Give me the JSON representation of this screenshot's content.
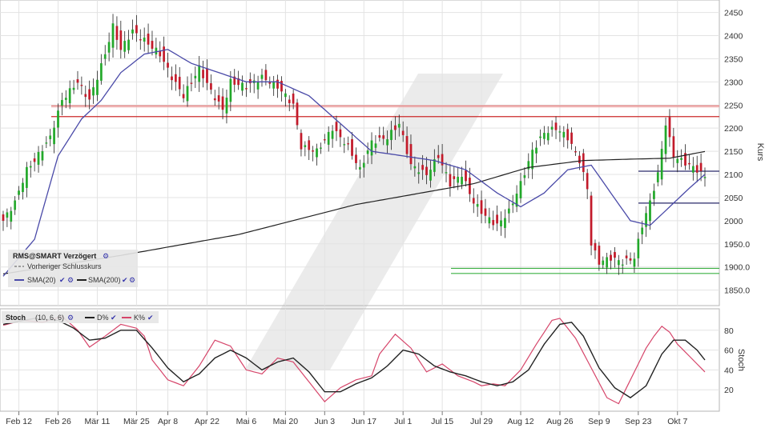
{
  "legend": {
    "symbol": "RMS@SMART Verzögert",
    "prev_close": "Vorheriger Schlusskurs",
    "sma20": "SMA(20)",
    "sma200": "SMA(200)",
    "stoch": "Stoch",
    "stoch_params": "(10, 6, 6)",
    "d_label": "D%",
    "k_label": "K%"
  },
  "colors": {
    "up": "#22a82a",
    "down": "#c21a2a",
    "sma20": "#4a4aa8",
    "sma200": "#222222",
    "resistance": "#cc2a2a",
    "support": "#3cb043",
    "k_line": "#d6456a",
    "d_line": "#222222",
    "grid": "#e3e3e3"
  },
  "chart_data": [
    {
      "type": "candlestick",
      "ylabel": "Kurs",
      "ylim": [
        1820,
        2470
      ],
      "yticks": [
        "2450",
        "2400",
        "2350",
        "2300",
        "2250",
        "2200",
        "2150",
        "2100",
        "2050",
        "2000",
        "1950.0",
        "1900.0",
        "1850.0"
      ],
      "ytick_values": [
        2450,
        2400,
        2350,
        2300,
        2250,
        2200,
        2150,
        2100,
        2050,
        2000,
        1950,
        1900,
        1850
      ],
      "xticks": [
        "Feb 12",
        "Feb 26",
        "Mär 11",
        "Mär 25",
        "Apr 8",
        "Apr 22",
        "Mai 6",
        "Mai 20",
        "Jun 3",
        "Jun 17",
        "Jul 1",
        "Jul 15",
        "Jul 29",
        "Aug 12",
        "Aug 26",
        "Sep 9",
        "Sep 23",
        "Okt 7"
      ],
      "xtick_index": [
        4,
        14,
        24,
        34,
        42,
        52,
        62,
        72,
        82,
        92,
        102,
        112,
        122,
        132,
        142,
        152,
        162,
        172
      ],
      "n_bars": 180,
      "close_anchors": [
        [
          0,
          2000
        ],
        [
          3,
          2040
        ],
        [
          6,
          2110
        ],
        [
          8,
          2130
        ],
        [
          12,
          2180
        ],
        [
          15,
          2260
        ],
        [
          19,
          2300
        ],
        [
          22,
          2260
        ],
        [
          26,
          2360
        ],
        [
          28,
          2420
        ],
        [
          30,
          2370
        ],
        [
          33,
          2410
        ],
        [
          36,
          2390
        ],
        [
          40,
          2360
        ],
        [
          43,
          2310
        ],
        [
          46,
          2270
        ],
        [
          50,
          2330
        ],
        [
          53,
          2280
        ],
        [
          56,
          2240
        ],
        [
          58,
          2300
        ],
        [
          62,
          2290
        ],
        [
          66,
          2310
        ],
        [
          70,
          2290
        ],
        [
          74,
          2250
        ],
        [
          76,
          2160
        ],
        [
          80,
          2150
        ],
        [
          84,
          2200
        ],
        [
          88,
          2160
        ],
        [
          91,
          2110
        ],
        [
          94,
          2170
        ],
        [
          98,
          2180
        ],
        [
          101,
          2210
        ],
        [
          104,
          2120
        ],
        [
          108,
          2100
        ],
        [
          111,
          2140
        ],
        [
          114,
          2080
        ],
        [
          117,
          2100
        ],
        [
          120,
          2040
        ],
        [
          123,
          2010
        ],
        [
          126,
          1990
        ],
        [
          129,
          2020
        ],
        [
          132,
          2080
        ],
        [
          135,
          2150
        ],
        [
          138,
          2190
        ],
        [
          141,
          2200
        ],
        [
          144,
          2180
        ],
        [
          147,
          2130
        ],
        [
          149,
          2070
        ],
        [
          150,
          1950
        ],
        [
          152,
          1910
        ],
        [
          155,
          1920
        ],
        [
          158,
          1910
        ],
        [
          161,
          1920
        ],
        [
          163,
          1990
        ],
        [
          165,
          2040
        ],
        [
          167,
          2100
        ],
        [
          169,
          2210
        ],
        [
          171,
          2140
        ],
        [
          173,
          2130
        ],
        [
          175,
          2120
        ],
        [
          177,
          2110
        ],
        [
          179,
          2095
        ]
      ],
      "sma20_anchors": [
        [
          0,
          1880
        ],
        [
          8,
          1960
        ],
        [
          14,
          2140
        ],
        [
          20,
          2220
        ],
        [
          25,
          2260
        ],
        [
          30,
          2320
        ],
        [
          36,
          2360
        ],
        [
          42,
          2370
        ],
        [
          48,
          2340
        ],
        [
          55,
          2320
        ],
        [
          62,
          2300
        ],
        [
          70,
          2300
        ],
        [
          78,
          2270
        ],
        [
          86,
          2210
        ],
        [
          94,
          2150
        ],
        [
          102,
          2140
        ],
        [
          110,
          2130
        ],
        [
          118,
          2110
        ],
        [
          126,
          2060
        ],
        [
          132,
          2030
        ],
        [
          138,
          2060
        ],
        [
          144,
          2110
        ],
        [
          150,
          2120
        ],
        [
          155,
          2060
        ],
        [
          160,
          2000
        ],
        [
          165,
          1990
        ],
        [
          170,
          2030
        ],
        [
          175,
          2070
        ],
        [
          179,
          2100
        ]
      ],
      "sma200_anchors": [
        [
          0,
          1885
        ],
        [
          30,
          1925
        ],
        [
          60,
          1970
        ],
        [
          90,
          2035
        ],
        [
          120,
          2080
        ],
        [
          134,
          2115
        ],
        [
          148,
          2130
        ],
        [
          160,
          2133
        ],
        [
          170,
          2135
        ],
        [
          178,
          2148
        ]
      ],
      "resistance_levels": [
        2248,
        2225
      ],
      "support_levels": [
        1897,
        1886
      ],
      "level_marker_lines": [
        2107,
        2038
      ]
    },
    {
      "type": "line",
      "title": "Stoch",
      "ylabel": "Stoch",
      "ylim": [
        0,
        100
      ],
      "yticks": [
        "80",
        "60",
        "40",
        "20"
      ],
      "ytick_values": [
        80,
        60,
        40,
        20
      ],
      "series": [
        {
          "name": "K%",
          "anchors": [
            [
              0,
              85
            ],
            [
              5,
              90
            ],
            [
              10,
              88
            ],
            [
              15,
              94
            ],
            [
              19,
              80
            ],
            [
              22,
              63
            ],
            [
              26,
              74
            ],
            [
              30,
              86
            ],
            [
              34,
              82
            ],
            [
              36,
              74
            ],
            [
              38,
              50
            ],
            [
              42,
              30
            ],
            [
              46,
              24
            ],
            [
              50,
              44
            ],
            [
              54,
              70
            ],
            [
              58,
              64
            ],
            [
              62,
              40
            ],
            [
              66,
              36
            ],
            [
              70,
              52
            ],
            [
              74,
              48
            ],
            [
              78,
              28
            ],
            [
              82,
              8
            ],
            [
              86,
              22
            ],
            [
              90,
              30
            ],
            [
              94,
              34
            ],
            [
              96,
              56
            ],
            [
              100,
              76
            ],
            [
              104,
              62
            ],
            [
              108,
              38
            ],
            [
              112,
              46
            ],
            [
              116,
              34
            ],
            [
              120,
              28
            ],
            [
              122,
              24
            ],
            [
              125,
              26
            ],
            [
              128,
              24
            ],
            [
              132,
              40
            ],
            [
              136,
              66
            ],
            [
              140,
              90
            ],
            [
              142,
              92
            ],
            [
              146,
              72
            ],
            [
              150,
              42
            ],
            [
              154,
              12
            ],
            [
              157,
              6
            ],
            [
              160,
              30
            ],
            [
              164,
              62
            ],
            [
              166,
              74
            ],
            [
              168,
              84
            ],
            [
              170,
              78
            ],
            [
              172,
              66
            ],
            [
              175,
              54
            ],
            [
              179,
              38
            ]
          ]
        },
        {
          "name": "D%",
          "anchors": [
            [
              0,
              86
            ],
            [
              8,
              92
            ],
            [
              14,
              90
            ],
            [
              18,
              82
            ],
            [
              22,
              70
            ],
            [
              26,
              72
            ],
            [
              30,
              80
            ],
            [
              34,
              80
            ],
            [
              38,
              62
            ],
            [
              42,
              42
            ],
            [
              46,
              28
            ],
            [
              50,
              36
            ],
            [
              54,
              52
            ],
            [
              58,
              60
            ],
            [
              62,
              52
            ],
            [
              66,
              40
            ],
            [
              70,
              48
            ],
            [
              74,
              52
            ],
            [
              78,
              38
            ],
            [
              82,
              18
            ],
            [
              86,
              18
            ],
            [
              90,
              26
            ],
            [
              94,
              32
            ],
            [
              98,
              44
            ],
            [
              102,
              60
            ],
            [
              106,
              56
            ],
            [
              110,
              44
            ],
            [
              114,
              38
            ],
            [
              118,
              34
            ],
            [
              122,
              28
            ],
            [
              126,
              24
            ],
            [
              130,
              28
            ],
            [
              134,
              40
            ],
            [
              138,
              66
            ],
            [
              142,
              86
            ],
            [
              145,
              88
            ],
            [
              148,
              74
            ],
            [
              152,
              42
            ],
            [
              156,
              22
            ],
            [
              160,
              12
            ],
            [
              164,
              24
            ],
            [
              168,
              56
            ],
            [
              171,
              70
            ],
            [
              174,
              70
            ],
            [
              177,
              60
            ],
            [
              179,
              50
            ]
          ]
        }
      ]
    }
  ]
}
